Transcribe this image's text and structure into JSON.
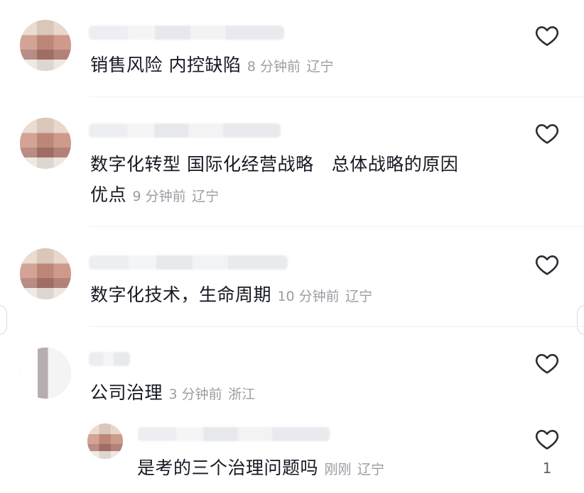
{
  "comments": [
    {
      "text": "销售风险 内控缺陷",
      "time": "8 分钟前",
      "location": "辽宁"
    },
    {
      "text_line1": "数字化转型 国际化经营战略   总体战略的原因",
      "text_line2": "优点",
      "time": "9 分钟前",
      "location": "辽宁"
    },
    {
      "text": "数字化技术，生命周期",
      "time": "10 分钟前",
      "location": "辽宁"
    },
    {
      "text": "公司治理",
      "time": "3 分钟前",
      "location": "浙江"
    }
  ],
  "reply": {
    "text": "是考的三个治理问题吗",
    "time": "刚刚",
    "location": "辽宁",
    "like_count": "1"
  },
  "icons": {
    "like": "heart-outline-icon"
  },
  "colors": {
    "text": "#161823",
    "meta": "#9b9ca2"
  }
}
